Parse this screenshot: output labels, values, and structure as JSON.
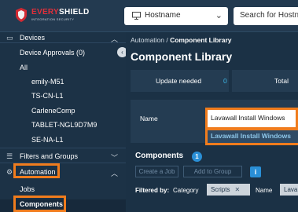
{
  "header": {
    "logo": {
      "brand_red": "EVERY",
      "brand_white": "SHIELD",
      "tagline": "INTEGRATION SECURITY"
    },
    "host_select": {
      "value": "Hostname",
      "icon": "monitor-icon"
    },
    "search": {
      "placeholder": "Search for Hostnar"
    }
  },
  "sidebar": {
    "devices_label": "Devices",
    "device_approvals_label": "Device Approvals (0)",
    "all_label": "All",
    "devices": [
      "emily-M51",
      "TS-CN-L1",
      "CarleneComp",
      "TABLET-NGL9D7M9",
      "SE-NA-L1"
    ],
    "filters_label": "Filters and Groups",
    "automation_label": "Automation",
    "jobs_label": "Jobs",
    "components_label": "Components"
  },
  "main": {
    "breadcrumb_parent": "Automation",
    "breadcrumb_sep": " / ",
    "breadcrumb_current": "Component Library",
    "title": "Component Library",
    "stats": [
      {
        "label": "Update needed",
        "value": "0"
      },
      {
        "label": "Total",
        "value": ""
      }
    ],
    "filter": {
      "name_label": "Name",
      "name_value": "Lavawall Install Windows",
      "suggestion": "Lavawall Install Windows"
    },
    "components_label": "Components",
    "components_count": "1",
    "create_job_label": "Create a Job",
    "add_to_group_label": "Add to Group",
    "info_label": "i",
    "filtered_by_label": "Filtered by:",
    "category_label": "Category",
    "category_chip": "Scripts",
    "chip_close": "✕",
    "name_filter_label": "Name",
    "name_chip": "Lava"
  },
  "colors": {
    "accent_orange": "#f07c1d",
    "accent_blue": "#2a8fd6",
    "sidebar_bg": "#1c3246"
  }
}
